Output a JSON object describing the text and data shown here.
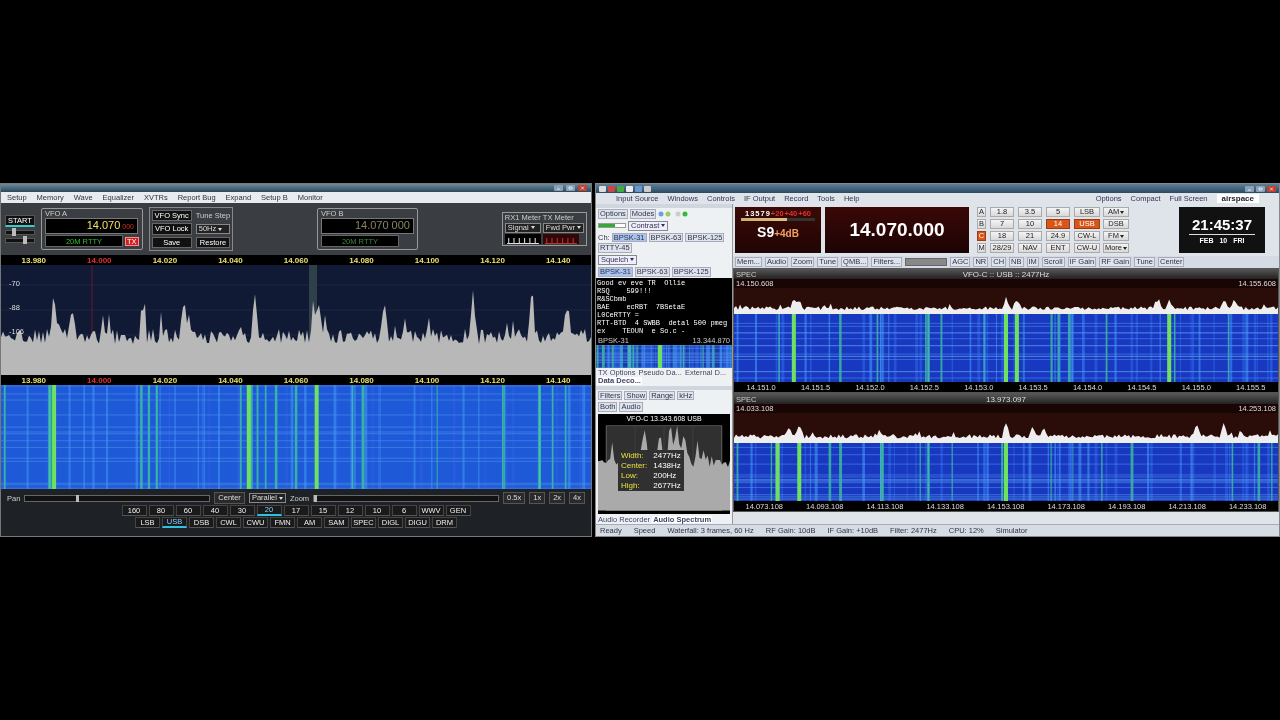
{
  "left_window": {
    "menu": [
      "Setup",
      "Memory",
      "Wave",
      "Equalizer",
      "XVTRs",
      "Report Bug",
      "Expand",
      "Setup B",
      "Monitor"
    ],
    "start_button": "START",
    "sliders": [
      {
        "level": 0.25
      },
      {
        "level": 0.7
      }
    ],
    "vfo_a": {
      "label": "VFO A",
      "frequency": "14.070",
      "frequency_hz": "000",
      "band": "20M RTTY",
      "tx_button": "TX"
    },
    "vfo_buttons": [
      "VFO Sync",
      "VFO Lock"
    ],
    "tune_step": {
      "label": "Tune Step",
      "value": "50Hz"
    },
    "memory_buttons": [
      "Save",
      "Restore"
    ],
    "vfo_b": {
      "label": "VFO B",
      "frequency": "14.070 000",
      "band": "20M RTTY"
    },
    "meters": [
      {
        "label": "RX1 Meter",
        "value": "Signal"
      },
      {
        "label": "TX Meter",
        "value": "Fwd Pwr"
      }
    ],
    "scale_top": [
      {
        "label": "13.980",
        "kind": "tick"
      },
      {
        "label": "14.000",
        "kind": "band_edge"
      },
      {
        "label": "14.020",
        "kind": "tick"
      },
      {
        "label": "14.040",
        "kind": "tick"
      },
      {
        "label": "14.060",
        "kind": "tick"
      },
      {
        "label": "14.080",
        "kind": "tick"
      },
      {
        "label": "14.100",
        "kind": "tick"
      },
      {
        "label": "14.120",
        "kind": "tick"
      },
      {
        "label": "14.140",
        "kind": "tick"
      }
    ],
    "db_scale": [
      "-70",
      "-88",
      "-106"
    ],
    "scale_bottom": [
      {
        "label": "13.980",
        "kind": "tick"
      },
      {
        "label": "14.000",
        "kind": "band_edge"
      },
      {
        "label": "14.020",
        "kind": "tick"
      },
      {
        "label": "14.040",
        "kind": "tick"
      },
      {
        "label": "14.060",
        "kind": "tick"
      },
      {
        "label": "14.080",
        "kind": "tick"
      },
      {
        "label": "14.100",
        "kind": "tick"
      },
      {
        "label": "14.120",
        "kind": "tick"
      },
      {
        "label": "14.140",
        "kind": "tick"
      }
    ],
    "pan": {
      "label": "Pan",
      "level": 0.28
    },
    "center_button": "Center",
    "display_mode": "Parallel",
    "zoom": {
      "label": "Zoom",
      "level": 0.0
    },
    "zoom_buttons": [
      "0.5x",
      "1x",
      "2x",
      "4x"
    ],
    "bands": [
      {
        "label": "160",
        "selected": false
      },
      {
        "label": "80",
        "selected": false
      },
      {
        "label": "60",
        "selected": false
      },
      {
        "label": "40",
        "selected": false
      },
      {
        "label": "30",
        "selected": false
      },
      {
        "label": "20",
        "selected": true
      },
      {
        "label": "17",
        "selected": false
      },
      {
        "label": "15",
        "selected": false
      },
      {
        "label": "12",
        "selected": false
      },
      {
        "label": "10",
        "selected": false
      },
      {
        "label": "6",
        "selected": false
      },
      {
        "label": "WWV",
        "selected": false
      },
      {
        "label": "GEN",
        "selected": false
      }
    ],
    "modes": [
      {
        "label": "LSB",
        "selected": false
      },
      {
        "label": "USB",
        "selected": true
      },
      {
        "label": "DSB",
        "selected": false
      },
      {
        "label": "CWL",
        "selected": false
      },
      {
        "label": "CWU",
        "selected": false
      },
      {
        "label": "FMN",
        "selected": false
      },
      {
        "label": "AM",
        "selected": false
      },
      {
        "label": "SAM",
        "selected": false
      },
      {
        "label": "SPEC",
        "selected": false
      },
      {
        "label": "DIGL",
        "selected": false
      },
      {
        "label": "DIGU",
        "selected": false
      },
      {
        "label": "DRM",
        "selected": false
      }
    ]
  },
  "right_window": {
    "menu": [
      "Input Source",
      "Windows",
      "Controls",
      "IF Output",
      "Record",
      "Tools",
      "Help"
    ],
    "menu_right": [
      "Options",
      "Compact",
      "Full Screen"
    ],
    "logo": "airspace",
    "digital_panel": {
      "toolbar": [
        "Options",
        "Modes"
      ],
      "contrast_label": "Contrast",
      "channel_label": "Ch:",
      "channels": [
        {
          "label": "BPSK-31",
          "selected": true
        },
        {
          "label": "BPSK-63",
          "selected": false
        },
        {
          "label": "BPSK-125",
          "selected": false
        },
        {
          "label": "RTTY-45",
          "selected": false
        }
      ],
      "squelch_label": "Squelch",
      "mode_tabs": [
        {
          "label": "BPSK-31",
          "selected": true
        },
        {
          "label": "BPSK-63",
          "selected": false
        },
        {
          "label": "BPSK-125",
          "selected": false
        }
      ],
      "decoded_text": [
        "Good ev eve TR  Ollie",
        "RSQ    599!!!",
        "R&SCbmb",
        "BAE    ecRBT  7BSetaE",
        "L0CeRTTY =",
        "RTT-BTD  4 SWBB  detal 500 pmeg",
        "ex    TEOUN  e So.c -"
      ],
      "waterfall_title": "BPSK-31",
      "waterfall_frequency": "13.344.870",
      "tabs": [
        {
          "label": "TX Options",
          "selected": false
        },
        {
          "label": "Pseudo Da...",
          "selected": false
        },
        {
          "label": "External D...",
          "selected": false
        },
        {
          "label": "Data Deco...",
          "selected": true
        }
      ]
    },
    "audio_panel": {
      "toolbar": [
        "Filters",
        "Show",
        "Range",
        "kHz"
      ],
      "sub_toolbar": [
        "Both",
        "Audio"
      ],
      "title": "VFO-C  13.343.608  USB",
      "readout": [
        {
          "label": "Width:",
          "value": "2477Hz"
        },
        {
          "label": "Center:",
          "value": "1438Hz"
        },
        {
          "label": "Low:",
          "value": "200Hz"
        },
        {
          "label": "High:",
          "value": "2677Hz"
        }
      ],
      "tabs": [
        {
          "label": "Audio Recorder",
          "selected": false
        },
        {
          "label": "Audio Spectrum",
          "selected": true
        }
      ]
    },
    "s_meter": {
      "scale": [
        {
          "label": "1",
          "kind": "s_unit"
        },
        {
          "label": "3",
          "kind": "s_unit"
        },
        {
          "label": "5",
          "kind": "s_unit"
        },
        {
          "label": "7",
          "kind": "s_unit"
        },
        {
          "label": "9",
          "kind": "s_unit"
        },
        {
          "label": "+20",
          "kind": "over"
        },
        {
          "label": "+40",
          "kind": "over"
        },
        {
          "label": "+60",
          "kind": "over"
        }
      ],
      "level": 0.62,
      "reading": "S9",
      "reading_over": "+4dB"
    },
    "frequency": "14.070.000",
    "vfo_keys": [
      {
        "label": "A",
        "selected": false
      },
      {
        "label": "B",
        "selected": false
      },
      {
        "label": "C",
        "selected": true
      },
      {
        "label": "M",
        "selected": false
      }
    ],
    "band_keys": [
      {
        "label": "1.8",
        "selected": false
      },
      {
        "label": "3.5",
        "selected": false
      },
      {
        "label": "5",
        "selected": false
      },
      {
        "label": "7",
        "selected": false
      },
      {
        "label": "10",
        "selected": false
      },
      {
        "label": "14",
        "selected": true
      },
      {
        "label": "18",
        "selected": false
      },
      {
        "label": "21",
        "selected": false
      },
      {
        "label": "24.9",
        "selected": false
      },
      {
        "label": "28/29",
        "selected": false
      },
      {
        "label": "NAV",
        "selected": false
      },
      {
        "label": "ENT",
        "selected": false
      }
    ],
    "mode_keys": [
      {
        "label": "LSB",
        "selected": false,
        "dropdown": false
      },
      {
        "label": "AM",
        "selected": false,
        "dropdown": true
      },
      {
        "label": "USB",
        "selected": true,
        "dropdown": false
      },
      {
        "label": "DSB",
        "selected": false,
        "dropdown": false
      },
      {
        "label": "CW-L",
        "selected": false,
        "dropdown": false
      },
      {
        "label": "FM",
        "selected": false,
        "dropdown": true
      },
      {
        "label": "CW-U",
        "selected": false,
        "dropdown": false
      },
      {
        "label": "More",
        "selected": false,
        "dropdown": true
      }
    ],
    "clock": {
      "time": "21:45:37",
      "date": [
        "FEB",
        "10",
        "FRI"
      ]
    },
    "toolbar": [
      "Mem...",
      "Audio",
      "Zoom",
      "Tune",
      "QMB...",
      "Filters..."
    ],
    "toolbar_right": [
      "AGC",
      "NR",
      "CH",
      "NB",
      "IM",
      "Scroll",
      "IF Gain",
      "RF Gain"
    ],
    "toolbar_end": [
      "Tune",
      "Center"
    ],
    "top_spectrum": {
      "tag": "SPEC",
      "title": "VFO-C  ::  USB  ::  2477Hz",
      "left_frequency": "14.150.608",
      "right_frequency": "14.155.608",
      "scale": [
        "14.151.0",
        "14.151.5",
        "14.152.0",
        "14.152.5",
        "14.153.0",
        "14.153.5",
        "14.154.0",
        "14.154.5",
        "14.155.0",
        "14.155.5"
      ]
    },
    "bottom_spectrum": {
      "tag": "SPEC",
      "title": "13.973.097",
      "left_frequency": "14.033.108",
      "right_frequency": "14.253.108",
      "scale": [
        "14.073.108",
        "14.093.108",
        "14.113.108",
        "14.133.108",
        "14.153.108",
        "14.173.108",
        "14.193.108",
        "14.213.108",
        "14.233.108"
      ]
    },
    "status_bar": [
      "Ready",
      "Speed",
      "Waterfall: 3 frames, 60 Hz",
      "RF Gain: 10dB",
      "IF Gain: +10dB",
      "Filter: 2477Hz",
      "CPU: 12%",
      "Simulator"
    ]
  }
}
